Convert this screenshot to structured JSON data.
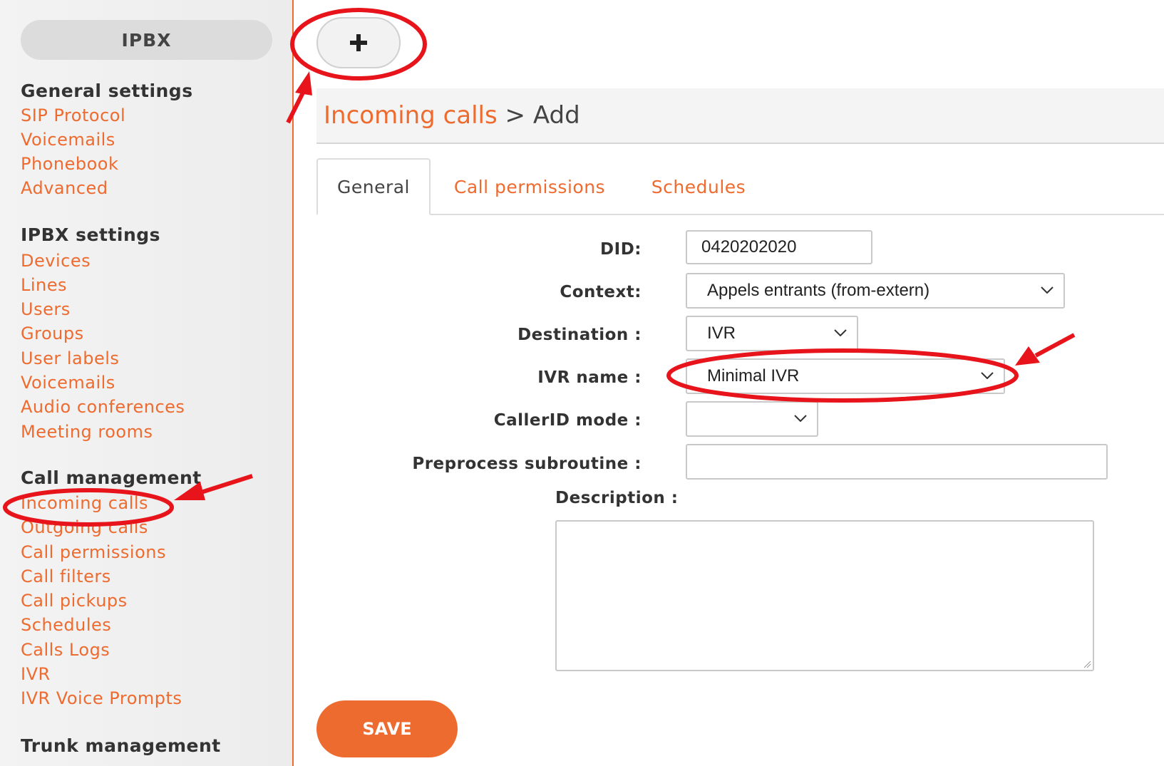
{
  "sidebar": {
    "title": "IPBX",
    "sections": [
      {
        "heading": "General settings",
        "items": [
          "SIP Protocol",
          "Voicemails",
          "Phonebook",
          "Advanced"
        ]
      },
      {
        "heading": "IPBX settings",
        "items": [
          "Devices",
          "Lines",
          "Users",
          "Groups",
          "User labels",
          "Voicemails",
          "Audio conferences",
          "Meeting rooms"
        ]
      },
      {
        "heading": "Call management",
        "items": [
          "Incoming calls",
          "Outgoing calls",
          "Call permissions",
          "Call filters",
          "Call pickups",
          "Schedules",
          "Calls Logs",
          "IVR",
          "IVR Voice Prompts"
        ]
      },
      {
        "heading": "Trunk management",
        "items": []
      }
    ]
  },
  "toolbar": {
    "add_icon": "plus-icon"
  },
  "breadcrumb": {
    "link": "Incoming calls",
    "separator": " > ",
    "current": "Add"
  },
  "tabs": [
    {
      "label": "General",
      "active": true
    },
    {
      "label": "Call permissions",
      "active": false
    },
    {
      "label": "Schedules",
      "active": false
    }
  ],
  "form": {
    "did": {
      "label": "DID:",
      "value": "0420202020"
    },
    "context": {
      "label": "Context:",
      "value": "Appels entrants (from-extern)"
    },
    "destination": {
      "label": "Destination :",
      "value": "IVR"
    },
    "ivr_name": {
      "label": "IVR name :",
      "value": "Minimal IVR"
    },
    "callerid_mode": {
      "label": "CallerID mode :",
      "value": ""
    },
    "preprocess_subroutine": {
      "label": "Preprocess subroutine :",
      "value": ""
    },
    "description": {
      "label": "Description :",
      "value": ""
    }
  },
  "actions": {
    "save_label": "SAVE"
  },
  "colors": {
    "accent": "#ee6b30",
    "annotation": "#e8141b"
  }
}
